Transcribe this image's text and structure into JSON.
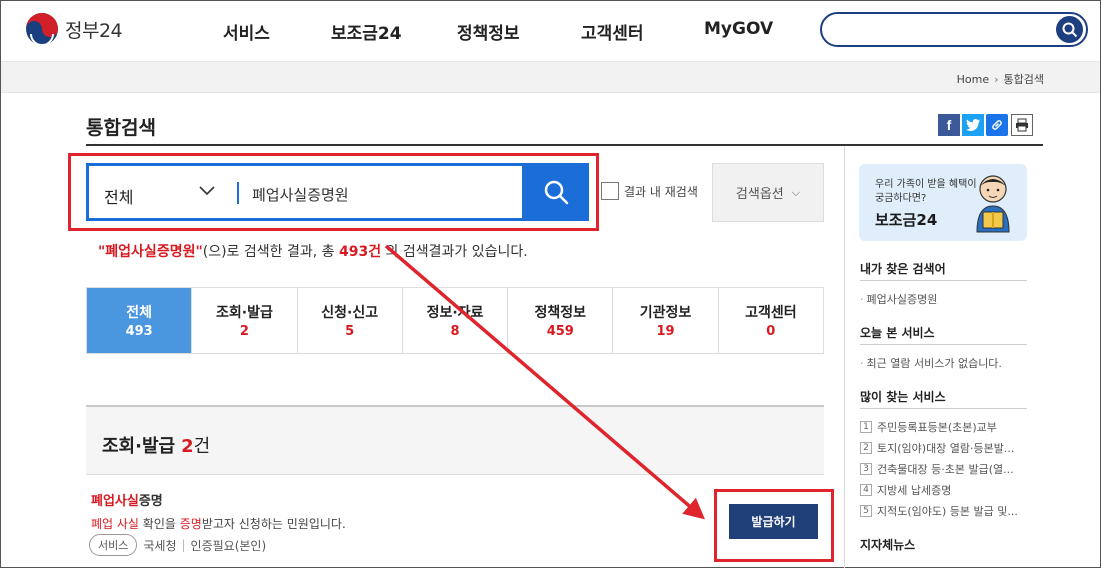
{
  "header": {
    "logo_text": "정부24",
    "nav": [
      "서비스",
      "보조금24",
      "정책정보",
      "고객센터",
      "MyGOV"
    ],
    "search_value": ""
  },
  "breadcrumb": {
    "home": "Home",
    "current": "통합검색"
  },
  "page_title": "통합검색",
  "search": {
    "scope": "전체",
    "query": "폐업사실증명원",
    "recheck_label": "결과 내 재검색",
    "options_label": "검색옵션"
  },
  "result": {
    "keyword": "\"폐업사실증명원\"",
    "pre": "(으)로 검색한 결과, 총 ",
    "total": "493건",
    "post": " 의 검색결과가 있습니다."
  },
  "tabs": [
    {
      "name": "전체",
      "count": "493"
    },
    {
      "name": "조회·발급",
      "count": "2"
    },
    {
      "name": "신청·신고",
      "count": "5"
    },
    {
      "name": "정보·자료",
      "count": "8"
    },
    {
      "name": "정책정보",
      "count": "459"
    },
    {
      "name": "기관정보",
      "count": "19"
    },
    {
      "name": "고객센터",
      "count": "0"
    }
  ],
  "section": {
    "title": "조회·발급",
    "count": "2",
    "unit": "건"
  },
  "item": {
    "title_hl": "폐업사실",
    "title_rest": "증명",
    "desc_hl1": "폐업 사실",
    "desc_mid": " 확인을 ",
    "desc_hl2": "증명",
    "desc_rest": "받고자 신청하는 민원입니다.",
    "chip": "서비스",
    "agency": "국세청",
    "auth": "인증필요(본인)",
    "button": "발급하기"
  },
  "sidebar": {
    "promo_sub": "우리 가족이 받을 혜택이 궁금하다면?",
    "promo_title": "보조금24",
    "recent_search_title": "내가 찾은 검색어",
    "recent_search_item": "폐업사실증명원",
    "viewed_title": "오늘 본 서비스",
    "viewed_empty": "최근 열람 서비스가 없습니다.",
    "popular_title": "많이 찾는 서비스",
    "popular": [
      "주민등록표등본(초본)교부",
      "토지(임야)대장 열람·등본발...",
      "건축물대장 등·초본 발급(열...",
      "지방세 납세증명",
      "지적도(임야도) 등본 발급 및..."
    ],
    "local_news_title": "지자체뉴스"
  },
  "colors": {
    "brand_blue": "#1b6ed8",
    "accent_red": "#d71a21",
    "active_tab": "#4a97e0",
    "navy": "#1e3f78"
  }
}
